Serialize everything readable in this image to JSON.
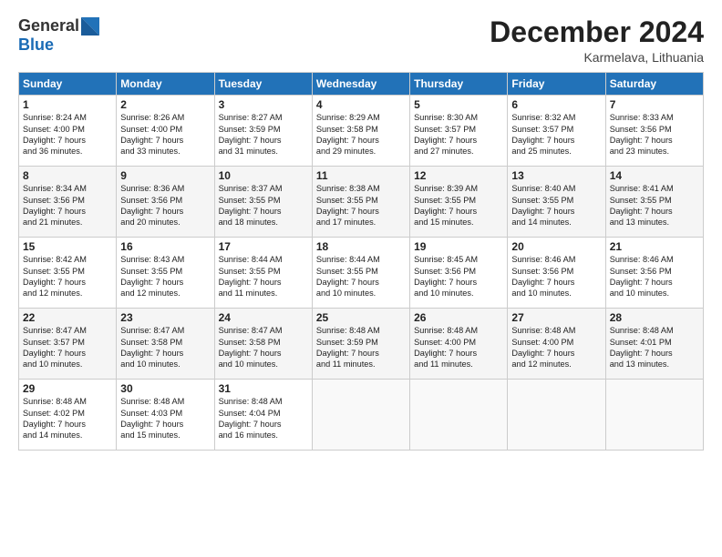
{
  "logo": {
    "general": "General",
    "blue": "Blue"
  },
  "header": {
    "month": "December 2024",
    "location": "Karmelava, Lithuania"
  },
  "weekdays": [
    "Sunday",
    "Monday",
    "Tuesday",
    "Wednesday",
    "Thursday",
    "Friday",
    "Saturday"
  ],
  "weeks": [
    [
      {
        "day": "1",
        "info": "Sunrise: 8:24 AM\nSunset: 4:00 PM\nDaylight: 7 hours\nand 36 minutes."
      },
      {
        "day": "2",
        "info": "Sunrise: 8:26 AM\nSunset: 4:00 PM\nDaylight: 7 hours\nand 33 minutes."
      },
      {
        "day": "3",
        "info": "Sunrise: 8:27 AM\nSunset: 3:59 PM\nDaylight: 7 hours\nand 31 minutes."
      },
      {
        "day": "4",
        "info": "Sunrise: 8:29 AM\nSunset: 3:58 PM\nDaylight: 7 hours\nand 29 minutes."
      },
      {
        "day": "5",
        "info": "Sunrise: 8:30 AM\nSunset: 3:57 PM\nDaylight: 7 hours\nand 27 minutes."
      },
      {
        "day": "6",
        "info": "Sunrise: 8:32 AM\nSunset: 3:57 PM\nDaylight: 7 hours\nand 25 minutes."
      },
      {
        "day": "7",
        "info": "Sunrise: 8:33 AM\nSunset: 3:56 PM\nDaylight: 7 hours\nand 23 minutes."
      }
    ],
    [
      {
        "day": "8",
        "info": "Sunrise: 8:34 AM\nSunset: 3:56 PM\nDaylight: 7 hours\nand 21 minutes."
      },
      {
        "day": "9",
        "info": "Sunrise: 8:36 AM\nSunset: 3:56 PM\nDaylight: 7 hours\nand 20 minutes."
      },
      {
        "day": "10",
        "info": "Sunrise: 8:37 AM\nSunset: 3:55 PM\nDaylight: 7 hours\nand 18 minutes."
      },
      {
        "day": "11",
        "info": "Sunrise: 8:38 AM\nSunset: 3:55 PM\nDaylight: 7 hours\nand 17 minutes."
      },
      {
        "day": "12",
        "info": "Sunrise: 8:39 AM\nSunset: 3:55 PM\nDaylight: 7 hours\nand 15 minutes."
      },
      {
        "day": "13",
        "info": "Sunrise: 8:40 AM\nSunset: 3:55 PM\nDaylight: 7 hours\nand 14 minutes."
      },
      {
        "day": "14",
        "info": "Sunrise: 8:41 AM\nSunset: 3:55 PM\nDaylight: 7 hours\nand 13 minutes."
      }
    ],
    [
      {
        "day": "15",
        "info": "Sunrise: 8:42 AM\nSunset: 3:55 PM\nDaylight: 7 hours\nand 12 minutes."
      },
      {
        "day": "16",
        "info": "Sunrise: 8:43 AM\nSunset: 3:55 PM\nDaylight: 7 hours\nand 12 minutes."
      },
      {
        "day": "17",
        "info": "Sunrise: 8:44 AM\nSunset: 3:55 PM\nDaylight: 7 hours\nand 11 minutes."
      },
      {
        "day": "18",
        "info": "Sunrise: 8:44 AM\nSunset: 3:55 PM\nDaylight: 7 hours\nand 10 minutes."
      },
      {
        "day": "19",
        "info": "Sunrise: 8:45 AM\nSunset: 3:56 PM\nDaylight: 7 hours\nand 10 minutes."
      },
      {
        "day": "20",
        "info": "Sunrise: 8:46 AM\nSunset: 3:56 PM\nDaylight: 7 hours\nand 10 minutes."
      },
      {
        "day": "21",
        "info": "Sunrise: 8:46 AM\nSunset: 3:56 PM\nDaylight: 7 hours\nand 10 minutes."
      }
    ],
    [
      {
        "day": "22",
        "info": "Sunrise: 8:47 AM\nSunset: 3:57 PM\nDaylight: 7 hours\nand 10 minutes."
      },
      {
        "day": "23",
        "info": "Sunrise: 8:47 AM\nSunset: 3:58 PM\nDaylight: 7 hours\nand 10 minutes."
      },
      {
        "day": "24",
        "info": "Sunrise: 8:47 AM\nSunset: 3:58 PM\nDaylight: 7 hours\nand 10 minutes."
      },
      {
        "day": "25",
        "info": "Sunrise: 8:48 AM\nSunset: 3:59 PM\nDaylight: 7 hours\nand 11 minutes."
      },
      {
        "day": "26",
        "info": "Sunrise: 8:48 AM\nSunset: 4:00 PM\nDaylight: 7 hours\nand 11 minutes."
      },
      {
        "day": "27",
        "info": "Sunrise: 8:48 AM\nSunset: 4:00 PM\nDaylight: 7 hours\nand 12 minutes."
      },
      {
        "day": "28",
        "info": "Sunrise: 8:48 AM\nSunset: 4:01 PM\nDaylight: 7 hours\nand 13 minutes."
      }
    ],
    [
      {
        "day": "29",
        "info": "Sunrise: 8:48 AM\nSunset: 4:02 PM\nDaylight: 7 hours\nand 14 minutes."
      },
      {
        "day": "30",
        "info": "Sunrise: 8:48 AM\nSunset: 4:03 PM\nDaylight: 7 hours\nand 15 minutes."
      },
      {
        "day": "31",
        "info": "Sunrise: 8:48 AM\nSunset: 4:04 PM\nDaylight: 7 hours\nand 16 minutes."
      },
      {
        "day": "",
        "info": ""
      },
      {
        "day": "",
        "info": ""
      },
      {
        "day": "",
        "info": ""
      },
      {
        "day": "",
        "info": ""
      }
    ]
  ]
}
